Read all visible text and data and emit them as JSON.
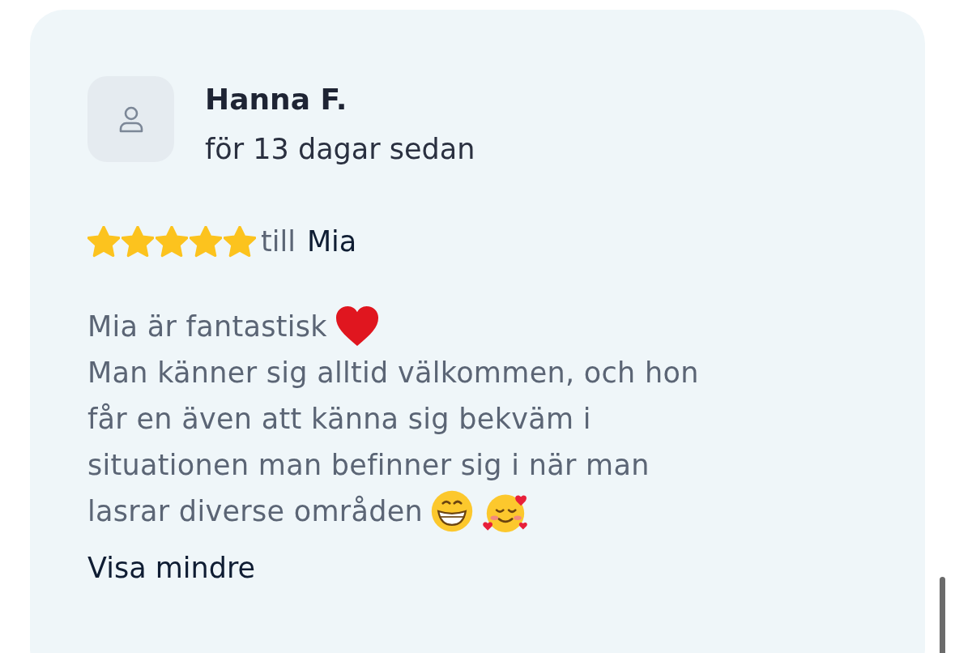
{
  "review": {
    "author": "Hanna F.",
    "date": "för 13 dagar sedan",
    "stars": 5,
    "to_prefix": "till",
    "to_name": "Mia",
    "lines": [
      {
        "text": "Mia är fantastisk",
        "emoji": [
          {
            "kind": "heart"
          }
        ]
      },
      {
        "text": "Man känner sig alltid välkommen, och hon"
      },
      {
        "text": "får en även att känna sig bekväm i"
      },
      {
        "text": "situationen man befinner sig i när man"
      },
      {
        "text": "lasrar diverse områden",
        "emoji": [
          {
            "kind": "grin"
          },
          {
            "kind": "hearts-face"
          }
        ]
      }
    ],
    "toggle": "Visa mindre"
  }
}
